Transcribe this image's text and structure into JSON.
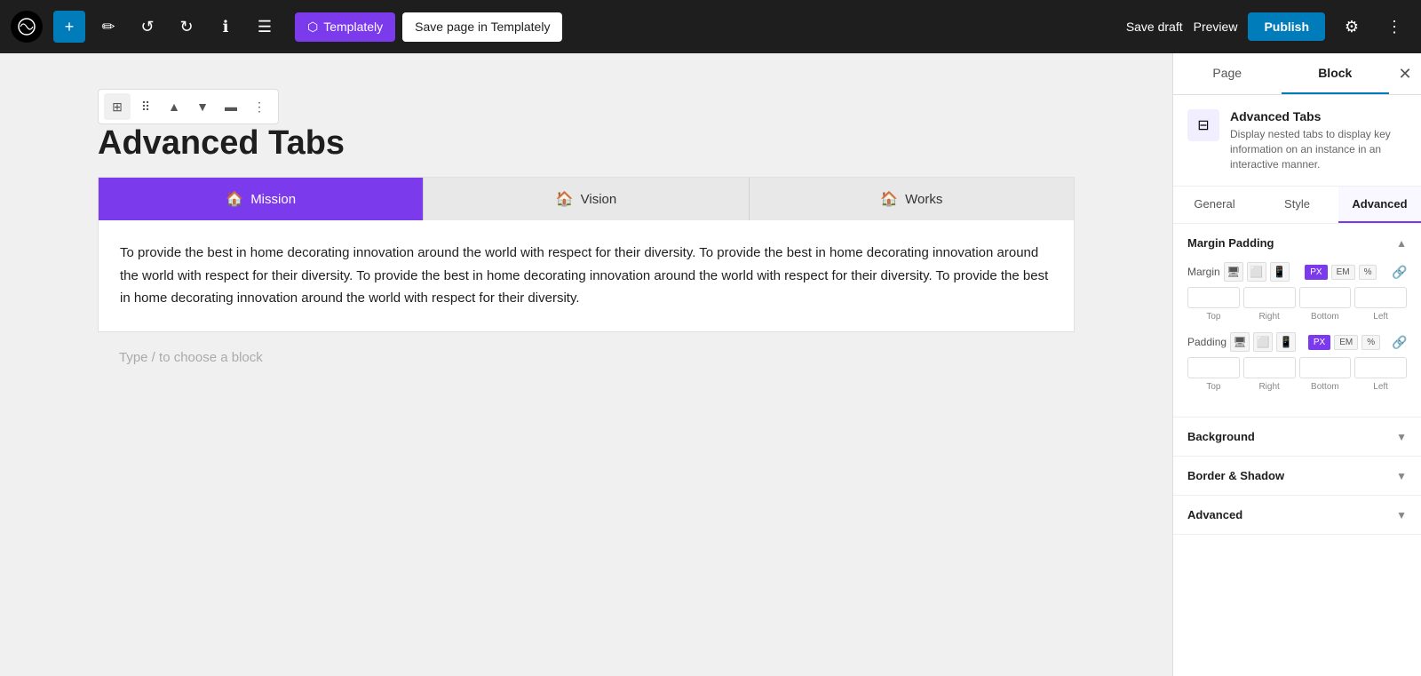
{
  "topbar": {
    "wp_logo": "W",
    "plus_label": "+",
    "undo_icon": "↺",
    "redo_icon": "↻",
    "info_icon": "ℹ",
    "tools_icon": "☰",
    "templately_label": "Templately",
    "save_templately_label": "Save page in Templately",
    "save_draft_label": "Save draft",
    "preview_label": "Preview",
    "publish_label": "Publish",
    "settings_icon": "⚙",
    "more_icon": "⋮"
  },
  "panel_tabs": {
    "page_label": "Page",
    "block_label": "Block"
  },
  "block_info": {
    "name": "Advanced Tabs",
    "desc": "Display nested tabs to display key information on an instance in an interactive manner."
  },
  "settings_tabs": [
    "General",
    "Style",
    "Advanced"
  ],
  "active_settings_tab": "Advanced",
  "margin_padding": {
    "section_label": "Margin Padding",
    "margin_label": "Margin",
    "padding_label": "Padding",
    "units": [
      "PX",
      "EM",
      "%"
    ],
    "active_unit": "PX",
    "top_label": "Top",
    "right_label": "Right",
    "bottom_label": "Bottom",
    "left_label": "Left"
  },
  "background_section": {
    "label": "Background"
  },
  "border_shadow_section": {
    "label": "Border & Shadow"
  },
  "advanced_section": {
    "label": "Advanced"
  },
  "canvas": {
    "page_title": "Advanced Tabs",
    "tabs": [
      {
        "label": "Mission",
        "icon": "🏠",
        "active": true
      },
      {
        "label": "Vision",
        "icon": "🏠",
        "active": false
      },
      {
        "label": "Works",
        "icon": "🏠",
        "active": false
      }
    ],
    "tab_content": "To provide the best in home decorating innovation around the world with respect for their diversity. To provide the best in home decorating innovation around the world with respect for their diversity. To provide the best in home decorating innovation around the world with respect for their diversity. To provide the best in home decorating innovation around the world with respect for their diversity.",
    "placeholder": "Type / to choose a block"
  }
}
